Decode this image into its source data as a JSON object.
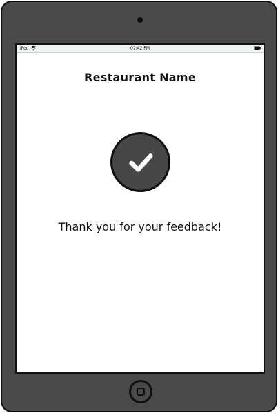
{
  "status_bar": {
    "carrier": "iPod",
    "wifi_icon": "wifi-icon",
    "time": "07:42 PM",
    "battery_icon": "battery-icon"
  },
  "app": {
    "title": "Restaurant Name",
    "check_icon": "checkmark-icon",
    "message": "Thank you for your feedback!"
  },
  "device": {
    "home_button_icon": "home-button-icon"
  },
  "colors": {
    "device_body": "#4a4a4a",
    "badge_fill": "#474747",
    "screen": "#ffffff",
    "text": "#111111"
  }
}
